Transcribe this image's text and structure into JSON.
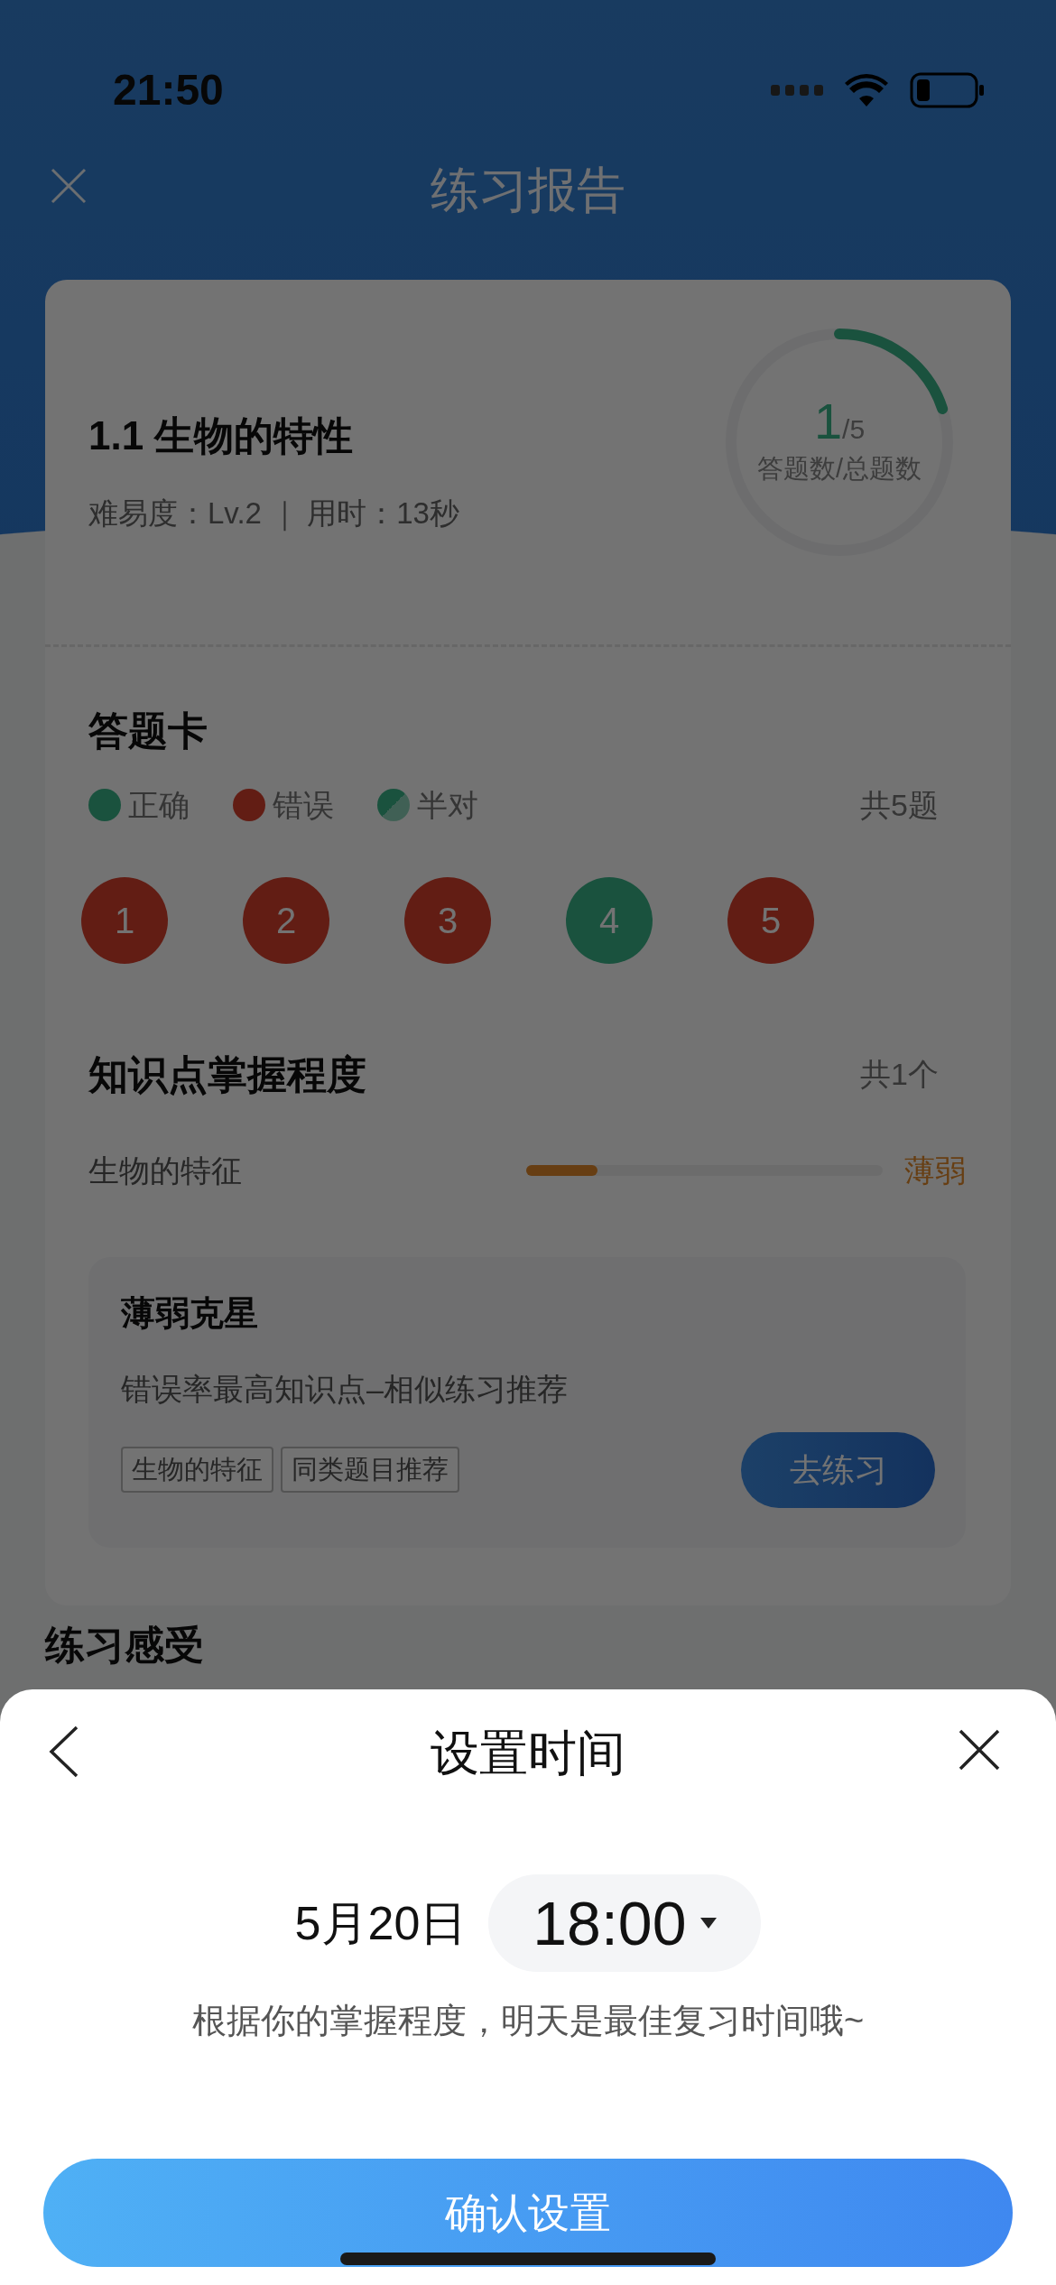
{
  "status_bar": {
    "time": "21:50"
  },
  "header": {
    "title": "练习报告"
  },
  "summary": {
    "title": "1.1 生物的特性",
    "meta": "难易度：Lv.2 ｜ 用时：13秒",
    "progress": {
      "answered": "1",
      "total": "/5",
      "caption": "答题数/总题数",
      "level": 0.2
    }
  },
  "answer_card": {
    "title": "答题卡",
    "legend": [
      {
        "label": "正确",
        "kind": "correct"
      },
      {
        "label": "错误",
        "kind": "wrong"
      },
      {
        "label": "半对",
        "kind": "half"
      }
    ],
    "total": "共5题",
    "questions": [
      {
        "number": "1",
        "kind": "wrong"
      },
      {
        "number": "2",
        "kind": "wrong"
      },
      {
        "number": "3",
        "kind": "wrong"
      },
      {
        "number": "4",
        "kind": "correct"
      },
      {
        "number": "5",
        "kind": "wrong"
      }
    ]
  },
  "knowledge": {
    "title": "知识点掌握程度",
    "count": "共1个",
    "items": [
      {
        "name": "生物的特征",
        "level": 0.2,
        "status": "薄弱"
      }
    ]
  },
  "recommendation": {
    "title": "薄弱克星",
    "subtitle": "错误率最高知识点–相似练习推荐",
    "tags": [
      "生物的特征",
      "同类题目推荐"
    ],
    "button": "去练习"
  },
  "feedback": {
    "title": "练习感受"
  },
  "sheet": {
    "title": "设置时间",
    "date": "5月20日",
    "time": "18:00",
    "hint": "根据你的掌握程度，明天是最佳复习时间哦~",
    "confirm": "确认设置"
  }
}
